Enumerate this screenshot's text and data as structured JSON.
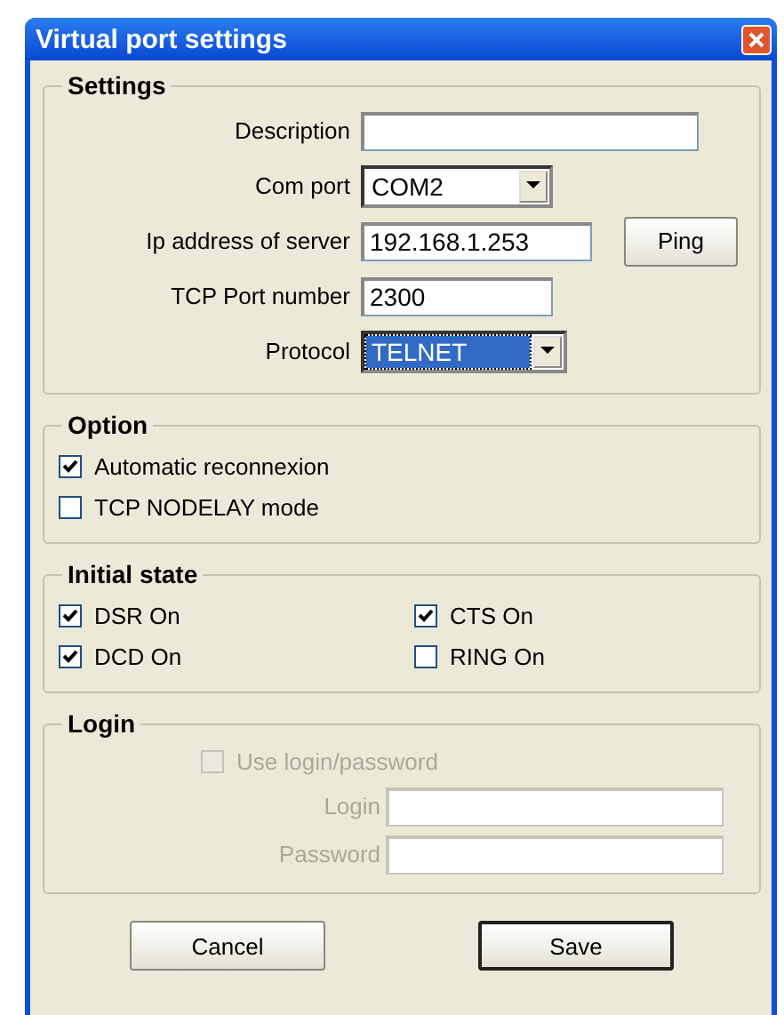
{
  "window": {
    "title": "Virtual port settings"
  },
  "settings": {
    "title": "Settings",
    "rows": [
      {
        "kind": "text",
        "label": "Description"
      },
      {
        "kind": "combo",
        "label": "Com port",
        "value": "COM2",
        "highlighted": false
      },
      {
        "kind": "text",
        "label": "Ip address of server",
        "value": "192.168.1.253",
        "button": "Ping"
      },
      {
        "kind": "text",
        "label": "TCP Port number",
        "value": "2300"
      },
      {
        "kind": "combo",
        "label": "Protocol",
        "value": "TELNET",
        "highlighted": true
      }
    ]
  },
  "option": {
    "title": "Option",
    "items": [
      {
        "label": "Automatic reconnexion",
        "checked": true
      },
      {
        "label": "TCP NODELAY mode",
        "checked": false
      }
    ]
  },
  "initial_state": {
    "title": "Initial state",
    "items": [
      {
        "label": "DSR On",
        "checked": true
      },
      {
        "label": "CTS On",
        "checked": true
      },
      {
        "label": "DCD On",
        "checked": true
      },
      {
        "label": "RING On",
        "checked": false
      }
    ]
  },
  "login": {
    "title": "Login",
    "disabled": true,
    "use_login": {
      "label": "Use login/password",
      "checked": false
    },
    "fields": [
      {
        "label": "Login"
      },
      {
        "label": "Password"
      }
    ]
  },
  "buttons": [
    {
      "label": "Cancel",
      "default": false
    },
    {
      "label": "Save",
      "default": true
    }
  ]
}
